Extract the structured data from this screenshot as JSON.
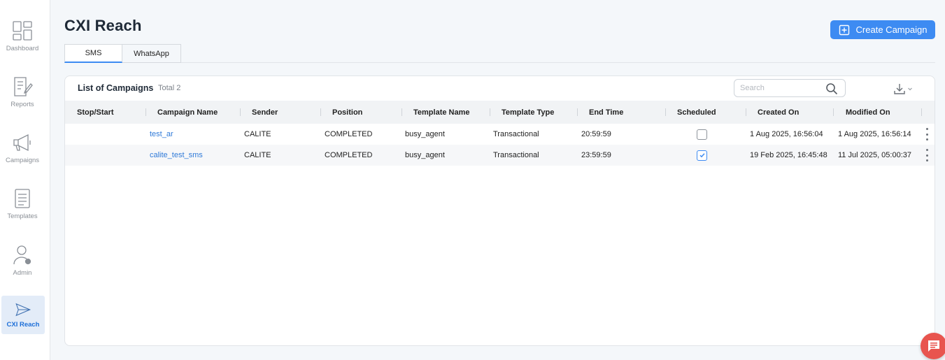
{
  "sidebar": {
    "items": [
      {
        "label": "Dashboard",
        "icon": "dashboard-icon"
      },
      {
        "label": "Reports",
        "icon": "report-icon"
      },
      {
        "label": "Campaigns",
        "icon": "megaphone-icon"
      },
      {
        "label": "Templates",
        "icon": "template-icon"
      },
      {
        "label": "Admin",
        "icon": "admin-user-icon"
      },
      {
        "label": "CXI Reach",
        "icon": "send-icon",
        "active": true
      }
    ]
  },
  "header": {
    "title": "CXI Reach",
    "create_button": "Create Campaign"
  },
  "tabs": [
    {
      "label": "SMS",
      "active": true
    },
    {
      "label": "WhatsApp",
      "active": false
    }
  ],
  "card": {
    "title": "List of Campaigns",
    "total": "Total 2",
    "search_placeholder": "Search"
  },
  "table": {
    "columns": [
      "Stop/Start",
      "Campaign Name",
      "Sender",
      "Position",
      "Template Name",
      "Template Type",
      "End Time",
      "Scheduled",
      "Created On",
      "Modified On"
    ],
    "rows": [
      {
        "name": "test_ar",
        "sender": "CALITE",
        "position": "COMPLETED",
        "template": "busy_agent",
        "type": "Transactional",
        "end": "20:59:59",
        "scheduled": false,
        "created": "1 Aug 2025, 16:56:04",
        "modified": "1 Aug 2025, 16:56:14"
      },
      {
        "name": "calite_test_sms",
        "sender": "CALITE",
        "position": "COMPLETED",
        "template": "busy_agent",
        "type": "Transactional",
        "end": "23:59:59",
        "scheduled": true,
        "created": "19 Feb 2025, 16:45:48",
        "modified": "11 Jul 2025, 05:00:37"
      }
    ]
  },
  "colors": {
    "primary": "#3d8bf2",
    "link": "#2f7ad8",
    "chat": "#e8544e"
  }
}
